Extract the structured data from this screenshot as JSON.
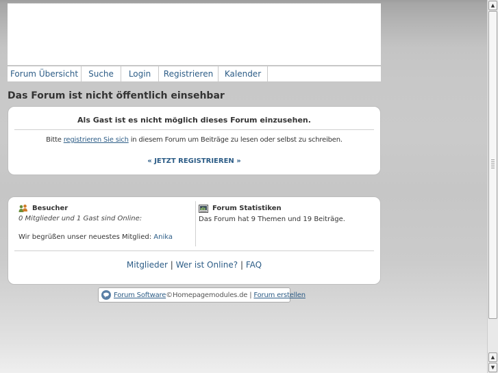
{
  "nav": {
    "items": [
      {
        "label": "Forum Übersicht"
      },
      {
        "label": "Suche"
      },
      {
        "label": "Login"
      },
      {
        "label": "Registrieren"
      },
      {
        "label": "Kalender"
      }
    ]
  },
  "page": {
    "title": "Das Forum ist nicht öffentlich einsehbar"
  },
  "guest_notice": {
    "heading": "Als Gast ist es nicht möglich dieses Forum einzusehen.",
    "text_before": "Bitte ",
    "link_label": "registrieren Sie sich",
    "text_after": " in diesem Forum um Beiträge zu lesen oder selbst zu schreiben.",
    "cta_label": "« JETZT REGISTRIEREN »"
  },
  "visitors": {
    "title": "Besucher",
    "online_text": "0 Mitglieder und 1 Gast sind Online:",
    "welcome_text": "Wir begrüßen unser neuestes Mitglied: ",
    "newest_member": "Anika",
    "icon": "users-icon"
  },
  "statistics": {
    "title": "Forum Statistiken",
    "summary": "Das Forum hat 9 Themen und 19 Beiträge.",
    "icon": "stats-icon"
  },
  "footer_links": {
    "members": "Mitglieder",
    "who_online": "Wer ist Online?",
    "faq": "FAQ",
    "separator": "|"
  },
  "credit": {
    "software_link": "Forum Software",
    "owner": "©Homepagemodules.de",
    "separator": "|",
    "create_link": "Forum erstellen",
    "icon": "forum-logo-icon"
  },
  "scrollbar": {
    "up_glyph": "▲",
    "down_glyph": "▼"
  },
  "colors": {
    "link": "#2c5c86",
    "text": "#333333",
    "card_border": "#bdbdbd"
  }
}
